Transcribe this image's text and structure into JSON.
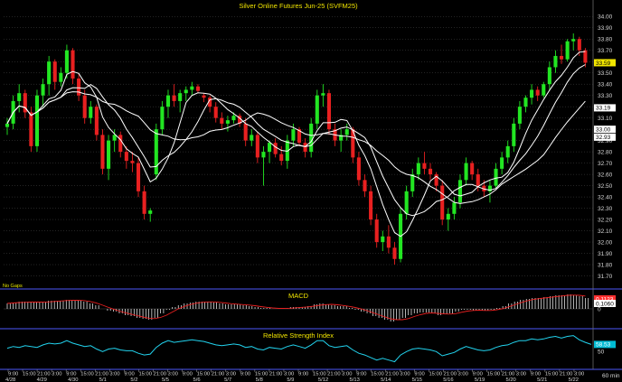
{
  "chart_data": [
    {
      "type": "candlestick",
      "title": "Silver Online Futures Jun-25  (SVFM25)",
      "ylim": [
        31.6,
        34.05
      ],
      "yticks": [
        "34.00",
        "33.90",
        "33.80",
        "33.70",
        "33.60",
        "33.50",
        "33.40",
        "33.30",
        "33.20",
        "33.10",
        "33.00",
        "32.90",
        "32.80",
        "32.70",
        "32.60",
        "32.50",
        "32.40",
        "32.30",
        "32.20",
        "32.10",
        "32.00",
        "31.90",
        "31.80",
        "31.70"
      ],
      "annotation": "No Gaps",
      "price_badges": [
        {
          "label": "33.59",
          "value": 33.59,
          "color": "#f2e600",
          "text_color": "#000000"
        },
        {
          "label": "33.19",
          "value": 33.19,
          "color": "#ffffff",
          "text_color": "#000000"
        },
        {
          "label": "33.00",
          "value": 33.0,
          "color": "#ffffff",
          "text_color": "#000000"
        },
        {
          "label": "32.93",
          "value": 32.93,
          "color": "#ffffff",
          "text_color": "#000000"
        }
      ],
      "candles": [
        [
          33.02,
          33.1,
          32.95,
          33.05
        ],
        [
          33.05,
          33.3,
          33.0,
          33.25
        ],
        [
          33.25,
          33.4,
          33.15,
          33.32
        ],
        [
          33.32,
          33.35,
          33.1,
          33.15
        ],
        [
          33.15,
          33.2,
          32.8,
          32.85
        ],
        [
          32.85,
          33.35,
          32.8,
          33.3
        ],
        [
          33.3,
          33.45,
          33.2,
          33.4
        ],
        [
          33.4,
          33.65,
          33.3,
          33.6
        ],
        [
          33.6,
          33.62,
          33.35,
          33.42
        ],
        [
          33.42,
          33.55,
          33.38,
          33.5
        ],
        [
          33.5,
          33.75,
          33.45,
          33.7
        ],
        [
          33.7,
          33.72,
          33.4,
          33.45
        ],
        [
          33.45,
          33.5,
          33.25,
          33.3
        ],
        [
          33.3,
          33.35,
          33.05,
          33.1
        ],
        [
          33.1,
          33.25,
          33.05,
          33.2
        ],
        [
          33.2,
          33.22,
          32.9,
          32.95
        ],
        [
          32.95,
          33.0,
          32.6,
          32.65
        ],
        [
          32.65,
          32.95,
          32.55,
          32.9
        ],
        [
          32.9,
          33.0,
          32.8,
          32.95
        ],
        [
          32.95,
          32.98,
          32.75,
          32.8
        ],
        [
          32.8,
          32.85,
          32.65,
          32.72
        ],
        [
          32.72,
          32.8,
          32.62,
          32.7
        ],
        [
          32.7,
          32.75,
          32.4,
          32.45
        ],
        [
          32.45,
          32.5,
          32.2,
          32.25
        ],
        [
          32.25,
          32.3,
          32.18,
          32.28
        ],
        [
          32.6,
          33.05,
          32.55,
          33.0
        ],
        [
          33.0,
          33.25,
          32.95,
          33.2
        ],
        [
          33.2,
          33.35,
          33.1,
          33.3
        ],
        [
          33.3,
          33.4,
          33.2,
          33.25
        ],
        [
          33.25,
          33.35,
          33.15,
          33.32
        ],
        [
          33.32,
          33.38,
          33.25,
          33.35
        ],
        [
          33.35,
          33.42,
          33.3,
          33.38
        ],
        [
          33.38,
          33.4,
          33.32,
          33.34
        ],
        [
          33.3,
          33.32,
          33.24,
          33.28
        ],
        [
          33.28,
          33.3,
          33.15,
          33.2
        ],
        [
          33.2,
          33.24,
          33.06,
          33.1
        ],
        [
          33.1,
          33.15,
          33.0,
          33.05
        ],
        [
          33.05,
          33.12,
          32.98,
          33.08
        ],
        [
          33.08,
          33.15,
          33.05,
          33.12
        ],
        [
          33.12,
          33.14,
          33.02,
          33.05
        ],
        [
          33.05,
          33.1,
          32.85,
          32.9
        ],
        [
          32.9,
          33.0,
          32.85,
          32.95
        ],
        [
          32.95,
          32.98,
          32.7,
          32.75
        ],
        [
          32.75,
          32.85,
          32.5,
          32.8
        ],
        [
          32.8,
          32.9,
          32.7,
          32.88
        ],
        [
          32.88,
          32.92,
          32.75,
          32.78
        ],
        [
          32.78,
          32.85,
          32.68,
          32.72
        ],
        [
          32.72,
          32.95,
          32.65,
          32.9
        ],
        [
          32.9,
          33.05,
          32.85,
          33.0
        ],
        [
          33.0,
          33.02,
          32.85,
          32.88
        ],
        [
          32.88,
          32.92,
          32.75,
          32.8
        ],
        [
          32.8,
          33.1,
          32.75,
          33.05
        ],
        [
          33.05,
          33.35,
          33.0,
          33.3
        ],
        [
          33.3,
          33.4,
          33.2,
          33.32
        ],
        [
          33.32,
          33.35,
          32.95,
          33.0
        ],
        [
          33.0,
          33.05,
          32.85,
          32.9
        ],
        [
          32.9,
          33.0,
          32.8,
          32.95
        ],
        [
          32.95,
          33.05,
          32.9,
          33.0
        ],
        [
          33.0,
          33.02,
          32.7,
          32.75
        ],
        [
          32.75,
          32.8,
          32.5,
          32.55
        ],
        [
          32.55,
          32.6,
          32.4,
          32.45
        ],
        [
          32.45,
          32.5,
          32.15,
          32.2
        ],
        [
          32.2,
          32.25,
          31.95,
          32.0
        ],
        [
          32.0,
          32.1,
          31.92,
          32.05
        ],
        [
          32.05,
          32.15,
          31.9,
          31.95
        ],
        [
          31.95,
          32.0,
          31.8,
          31.85
        ],
        [
          31.85,
          32.3,
          31.82,
          32.25
        ],
        [
          32.25,
          32.5,
          32.2,
          32.45
        ],
        [
          32.45,
          32.65,
          32.4,
          32.6
        ],
        [
          32.6,
          32.75,
          32.55,
          32.7
        ],
        [
          32.7,
          32.8,
          32.6,
          32.65
        ],
        [
          32.65,
          32.7,
          32.55,
          32.6
        ],
        [
          32.6,
          32.62,
          32.45,
          32.5
        ],
        [
          32.5,
          32.55,
          32.15,
          32.2
        ],
        [
          32.2,
          32.3,
          32.1,
          32.25
        ],
        [
          32.25,
          32.4,
          32.2,
          32.35
        ],
        [
          32.35,
          32.6,
          32.3,
          32.55
        ],
        [
          32.55,
          32.75,
          32.5,
          32.7
        ],
        [
          32.7,
          32.72,
          32.55,
          32.6
        ],
        [
          32.6,
          32.65,
          32.45,
          32.5
        ],
        [
          32.5,
          32.55,
          32.4,
          32.45
        ],
        [
          32.45,
          32.55,
          32.35,
          32.5
        ],
        [
          32.5,
          32.7,
          32.48,
          32.65
        ],
        [
          32.65,
          32.8,
          32.6,
          32.75
        ],
        [
          32.75,
          32.9,
          32.7,
          32.85
        ],
        [
          32.85,
          33.1,
          32.8,
          33.05
        ],
        [
          33.05,
          33.25,
          33.0,
          33.2
        ],
        [
          33.2,
          33.3,
          33.15,
          33.28
        ],
        [
          33.28,
          33.4,
          33.22,
          33.35
        ],
        [
          33.35,
          33.38,
          33.25,
          33.3
        ],
        [
          33.3,
          33.42,
          33.28,
          33.4
        ],
        [
          33.4,
          33.6,
          33.35,
          33.55
        ],
        [
          33.55,
          33.7,
          33.5,
          33.65
        ],
        [
          33.65,
          33.75,
          33.58,
          33.62
        ],
        [
          33.62,
          33.8,
          33.6,
          33.78
        ],
        [
          33.78,
          33.85,
          33.7,
          33.8
        ],
        [
          33.8,
          33.82,
          33.65,
          33.7
        ],
        [
          33.7,
          33.72,
          33.55,
          33.59
        ]
      ]
    },
    {
      "type": "histogram",
      "title": "MACD",
      "ylim": [
        -0.2,
        0.2
      ],
      "yticks": [
        "0"
      ],
      "price_badges": [
        {
          "label": "0.1123",
          "value": 0.11,
          "color": "#ff3030",
          "text_color": "#ffffff"
        },
        {
          "label": "0.1060",
          "value": 0.06,
          "color": "#ffffff",
          "text_color": "#000000"
        }
      ],
      "values": [
        0.06,
        0.07,
        0.08,
        0.08,
        0.07,
        0.07,
        0.08,
        0.09,
        0.09,
        0.09,
        0.1,
        0.1,
        0.09,
        0.08,
        0.06,
        0.04,
        0.0,
        -0.02,
        -0.03,
        -0.05,
        -0.07,
        -0.08,
        -0.1,
        -0.11,
        -0.12,
        -0.1,
        -0.05,
        -0.01,
        0.02,
        0.04,
        0.06,
        0.07,
        0.08,
        0.08,
        0.08,
        0.07,
        0.06,
        0.05,
        0.05,
        0.05,
        0.04,
        0.03,
        0.02,
        0.01,
        0.01,
        0.0,
        0.0,
        0.01,
        0.02,
        0.02,
        0.02,
        0.03,
        0.05,
        0.06,
        0.05,
        0.04,
        0.03,
        0.03,
        0.01,
        -0.01,
        -0.03,
        -0.05,
        -0.08,
        -0.1,
        -0.12,
        -0.14,
        -0.12,
        -0.1,
        -0.07,
        -0.05,
        -0.04,
        -0.04,
        -0.05,
        -0.07,
        -0.06,
        -0.05,
        -0.03,
        -0.01,
        -0.01,
        -0.02,
        -0.02,
        -0.02,
        -0.01,
        0.01,
        0.03,
        0.06,
        0.08,
        0.1,
        0.11,
        0.12,
        0.12,
        0.13,
        0.14,
        0.15,
        0.15,
        0.16,
        0.15,
        0.14,
        0.12
      ]
    },
    {
      "type": "line",
      "title": "Relative Strength Index",
      "ylim": [
        30,
        75
      ],
      "yticks": [
        "50"
      ],
      "price_badges": [
        {
          "label": "58.53",
          "value": 58.53,
          "color": "#00bcd4",
          "text_color": "#ffffff"
        }
      ],
      "values": [
        54,
        56,
        55,
        57,
        56,
        55,
        58,
        60,
        59,
        60,
        63,
        60,
        58,
        56,
        57,
        53,
        50,
        53,
        54,
        52,
        51,
        51,
        48,
        46,
        47,
        55,
        60,
        63,
        61,
        62,
        63,
        64,
        63,
        62,
        60,
        58,
        57,
        58,
        59,
        58,
        55,
        56,
        53,
        52,
        55,
        54,
        53,
        56,
        58,
        56,
        54,
        58,
        63,
        63,
        57,
        55,
        56,
        57,
        52,
        48,
        46,
        43,
        40,
        42,
        40,
        38,
        46,
        50,
        53,
        54,
        53,
        52,
        50,
        45,
        47,
        49,
        53,
        56,
        54,
        52,
        51,
        52,
        55,
        57,
        58,
        61,
        63,
        63,
        65,
        64,
        65,
        67,
        68,
        66,
        68,
        69,
        64,
        61,
        58.53
      ]
    }
  ],
  "x_axis": {
    "time_labels": [
      "9:00",
      "15:00",
      "21:00",
      "3:00",
      "9:00",
      "15:00",
      "21:00",
      "3:00",
      "9:00",
      "15:00",
      "21:00",
      "3:00",
      "9:00",
      "15:00",
      "21:00",
      "3:00",
      "9:00",
      "15:00",
      "21:00",
      "3:00",
      "9:00",
      "15:00",
      "21:00",
      "3:00",
      "9:00",
      "15:00",
      "21:00",
      "3:00",
      "9:00",
      "15:00",
      "21:00",
      "3:00",
      "9:00",
      "15:00",
      "21:00",
      "3:00",
      "9:00",
      "15:00",
      "21:00",
      "3:00"
    ],
    "date_labels": [
      "4/28",
      "4/29",
      "4/30",
      "5/1",
      "5/2",
      "5/5",
      "5/6",
      "5/7",
      "5/8",
      "5/9",
      "5/12",
      "5/13",
      "5/14",
      "5/15",
      "5/16",
      "5/19",
      "5/20",
      "5/21",
      "5/22"
    ],
    "interval_label": "60 min"
  },
  "colors": {
    "up": "#22e622",
    "down": "#e82020",
    "ma": "#ffffff",
    "rsi": "#22d3ee",
    "separator": "#3c46c8",
    "grid": "#4a4a4a"
  }
}
